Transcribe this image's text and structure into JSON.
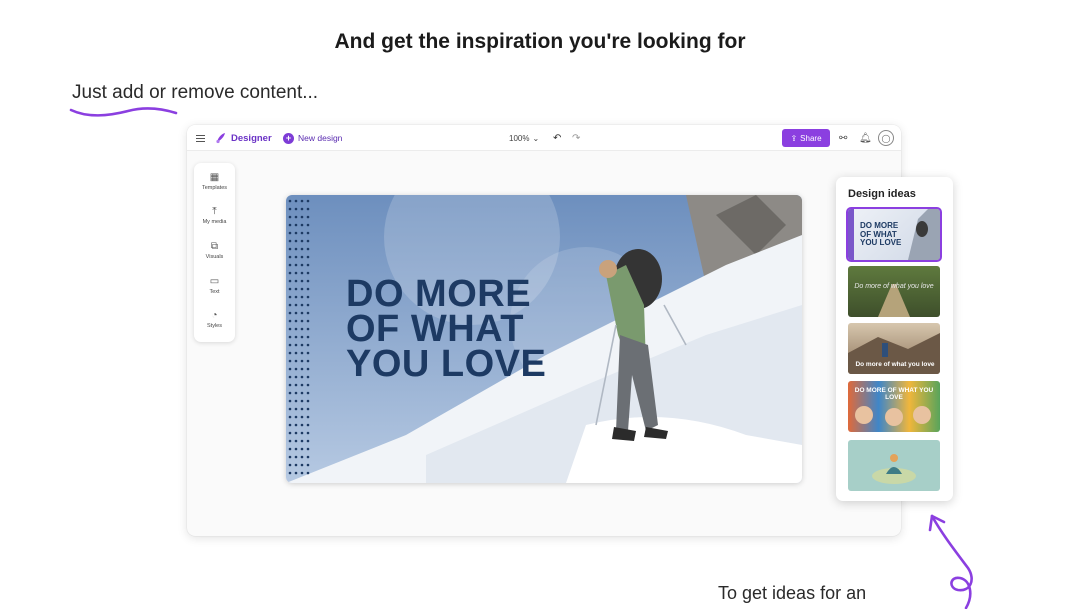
{
  "headline": "And get the inspiration you're looking for",
  "caption_left": "Just add or remove content...",
  "caption_right": "To get ideas for an",
  "app": {
    "name": "Designer",
    "new_design_label": "New design",
    "zoom_level": "100%",
    "share_label": "Share"
  },
  "rail": {
    "items": [
      {
        "label": "Templates",
        "icon": "templates-icon"
      },
      {
        "label": "My media",
        "icon": "upload-icon"
      },
      {
        "label": "Visuals",
        "icon": "visuals-icon"
      },
      {
        "label": "Text",
        "icon": "text-icon"
      },
      {
        "label": "Styles",
        "icon": "styles-icon"
      }
    ]
  },
  "canvas": {
    "line1": "DO MORE",
    "line2": "OF WHAT",
    "line3": "YOU LOVE"
  },
  "ideas": {
    "title": "Design ideas",
    "thumbs": [
      {
        "text1": "DO MORE",
        "text2": "OF WHAT",
        "text3": "YOU LOVE"
      },
      {
        "text": "Do more of what you love"
      },
      {
        "text": "Do more of what you love"
      },
      {
        "text": "DO MORE OF WHAT YOU LOVE"
      },
      {
        "text": ""
      }
    ]
  },
  "colors": {
    "accent": "#8b3fe0",
    "hero_text": "#1d3a63"
  }
}
